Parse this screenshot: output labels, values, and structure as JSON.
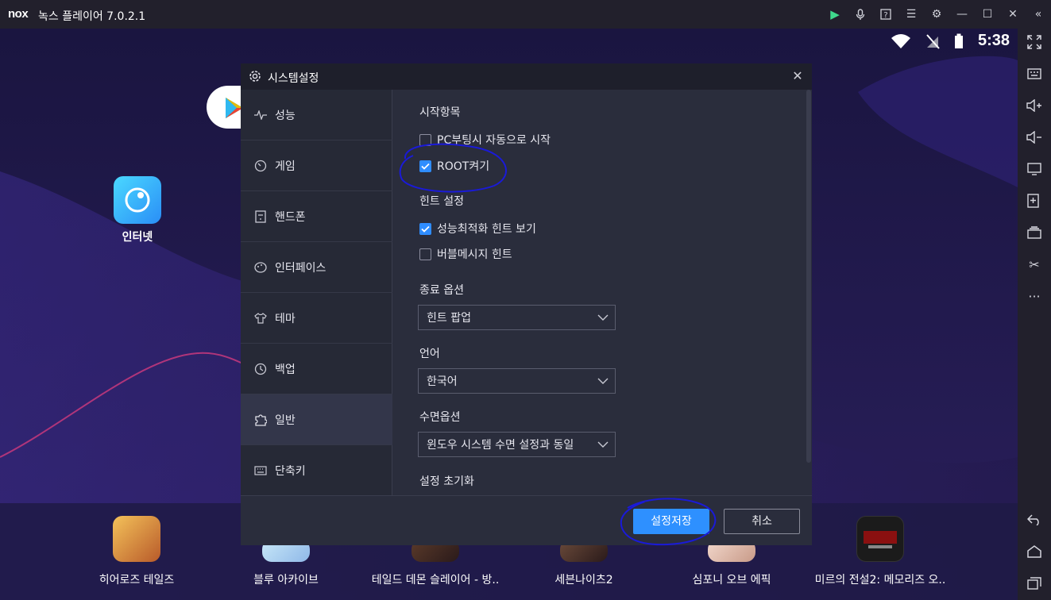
{
  "window": {
    "logo": "nox",
    "title": "녹스 플레이어 7.0.2.1"
  },
  "titlebar_icons": [
    "play-store-icon",
    "microphone-icon",
    "help-icon",
    "menu-icon",
    "gear-icon",
    "minimize-icon",
    "maximize-icon",
    "close-icon",
    "collapse-icon"
  ],
  "statusbar": {
    "time": "5:38"
  },
  "desktop": {
    "apps": [
      {
        "label": "인터넷"
      }
    ]
  },
  "dock": [
    {
      "label": "히어로즈 테일즈",
      "color": "#e7a13a"
    },
    {
      "label": "블루 아카이브",
      "color": "#a7d8f0"
    },
    {
      "label": "테일드 데몬 슬레이어 - 방..",
      "color": "#3a2a2a"
    },
    {
      "label": "세븐나이츠2",
      "color": "#5b3a2e"
    },
    {
      "label": "심포니 오브 에픽",
      "color": "#e5c2b8"
    },
    {
      "label": "미르의 전설2: 메모리즈 오..",
      "color": "#1b1b1b"
    }
  ],
  "dialog": {
    "title": "시스템설정",
    "nav": [
      {
        "label": "성능",
        "icon": "pulse-icon"
      },
      {
        "label": "게임",
        "icon": "gamepad-icon"
      },
      {
        "label": "핸드폰",
        "icon": "phone-icon"
      },
      {
        "label": "인터페이스",
        "icon": "palette-icon"
      },
      {
        "label": "테마",
        "icon": "shirt-icon"
      },
      {
        "label": "백업",
        "icon": "history-icon"
      },
      {
        "label": "일반",
        "icon": "puzzle-icon",
        "active": true
      },
      {
        "label": "단축키",
        "icon": "keyboard-icon"
      }
    ],
    "startup": {
      "title": "시작항목",
      "options": [
        {
          "label": "PC부팅시 자동으로 시작",
          "checked": false
        },
        {
          "label": "ROOT켜기",
          "checked": true
        }
      ]
    },
    "hints": {
      "title": "힌트 설정",
      "options": [
        {
          "label": "성능최적화 힌트 보기",
          "checked": true
        },
        {
          "label": "버블메시지 힌트",
          "checked": false
        }
      ]
    },
    "exit_option": {
      "title": "종료 옵션",
      "value": "힌트 팝업"
    },
    "language": {
      "title": "언어",
      "value": "한국어"
    },
    "sleep_option": {
      "title": "수면옵션",
      "value": "윈도우 시스템 수면 설정과 동일"
    },
    "reset": {
      "title": "설정 초기화"
    },
    "save_label": "설정저장",
    "cancel_label": "취소"
  },
  "colors": {
    "accent": "#2e90ff",
    "dialog_bg": "#2a2d3c",
    "annotation": "#1a1ad8"
  }
}
